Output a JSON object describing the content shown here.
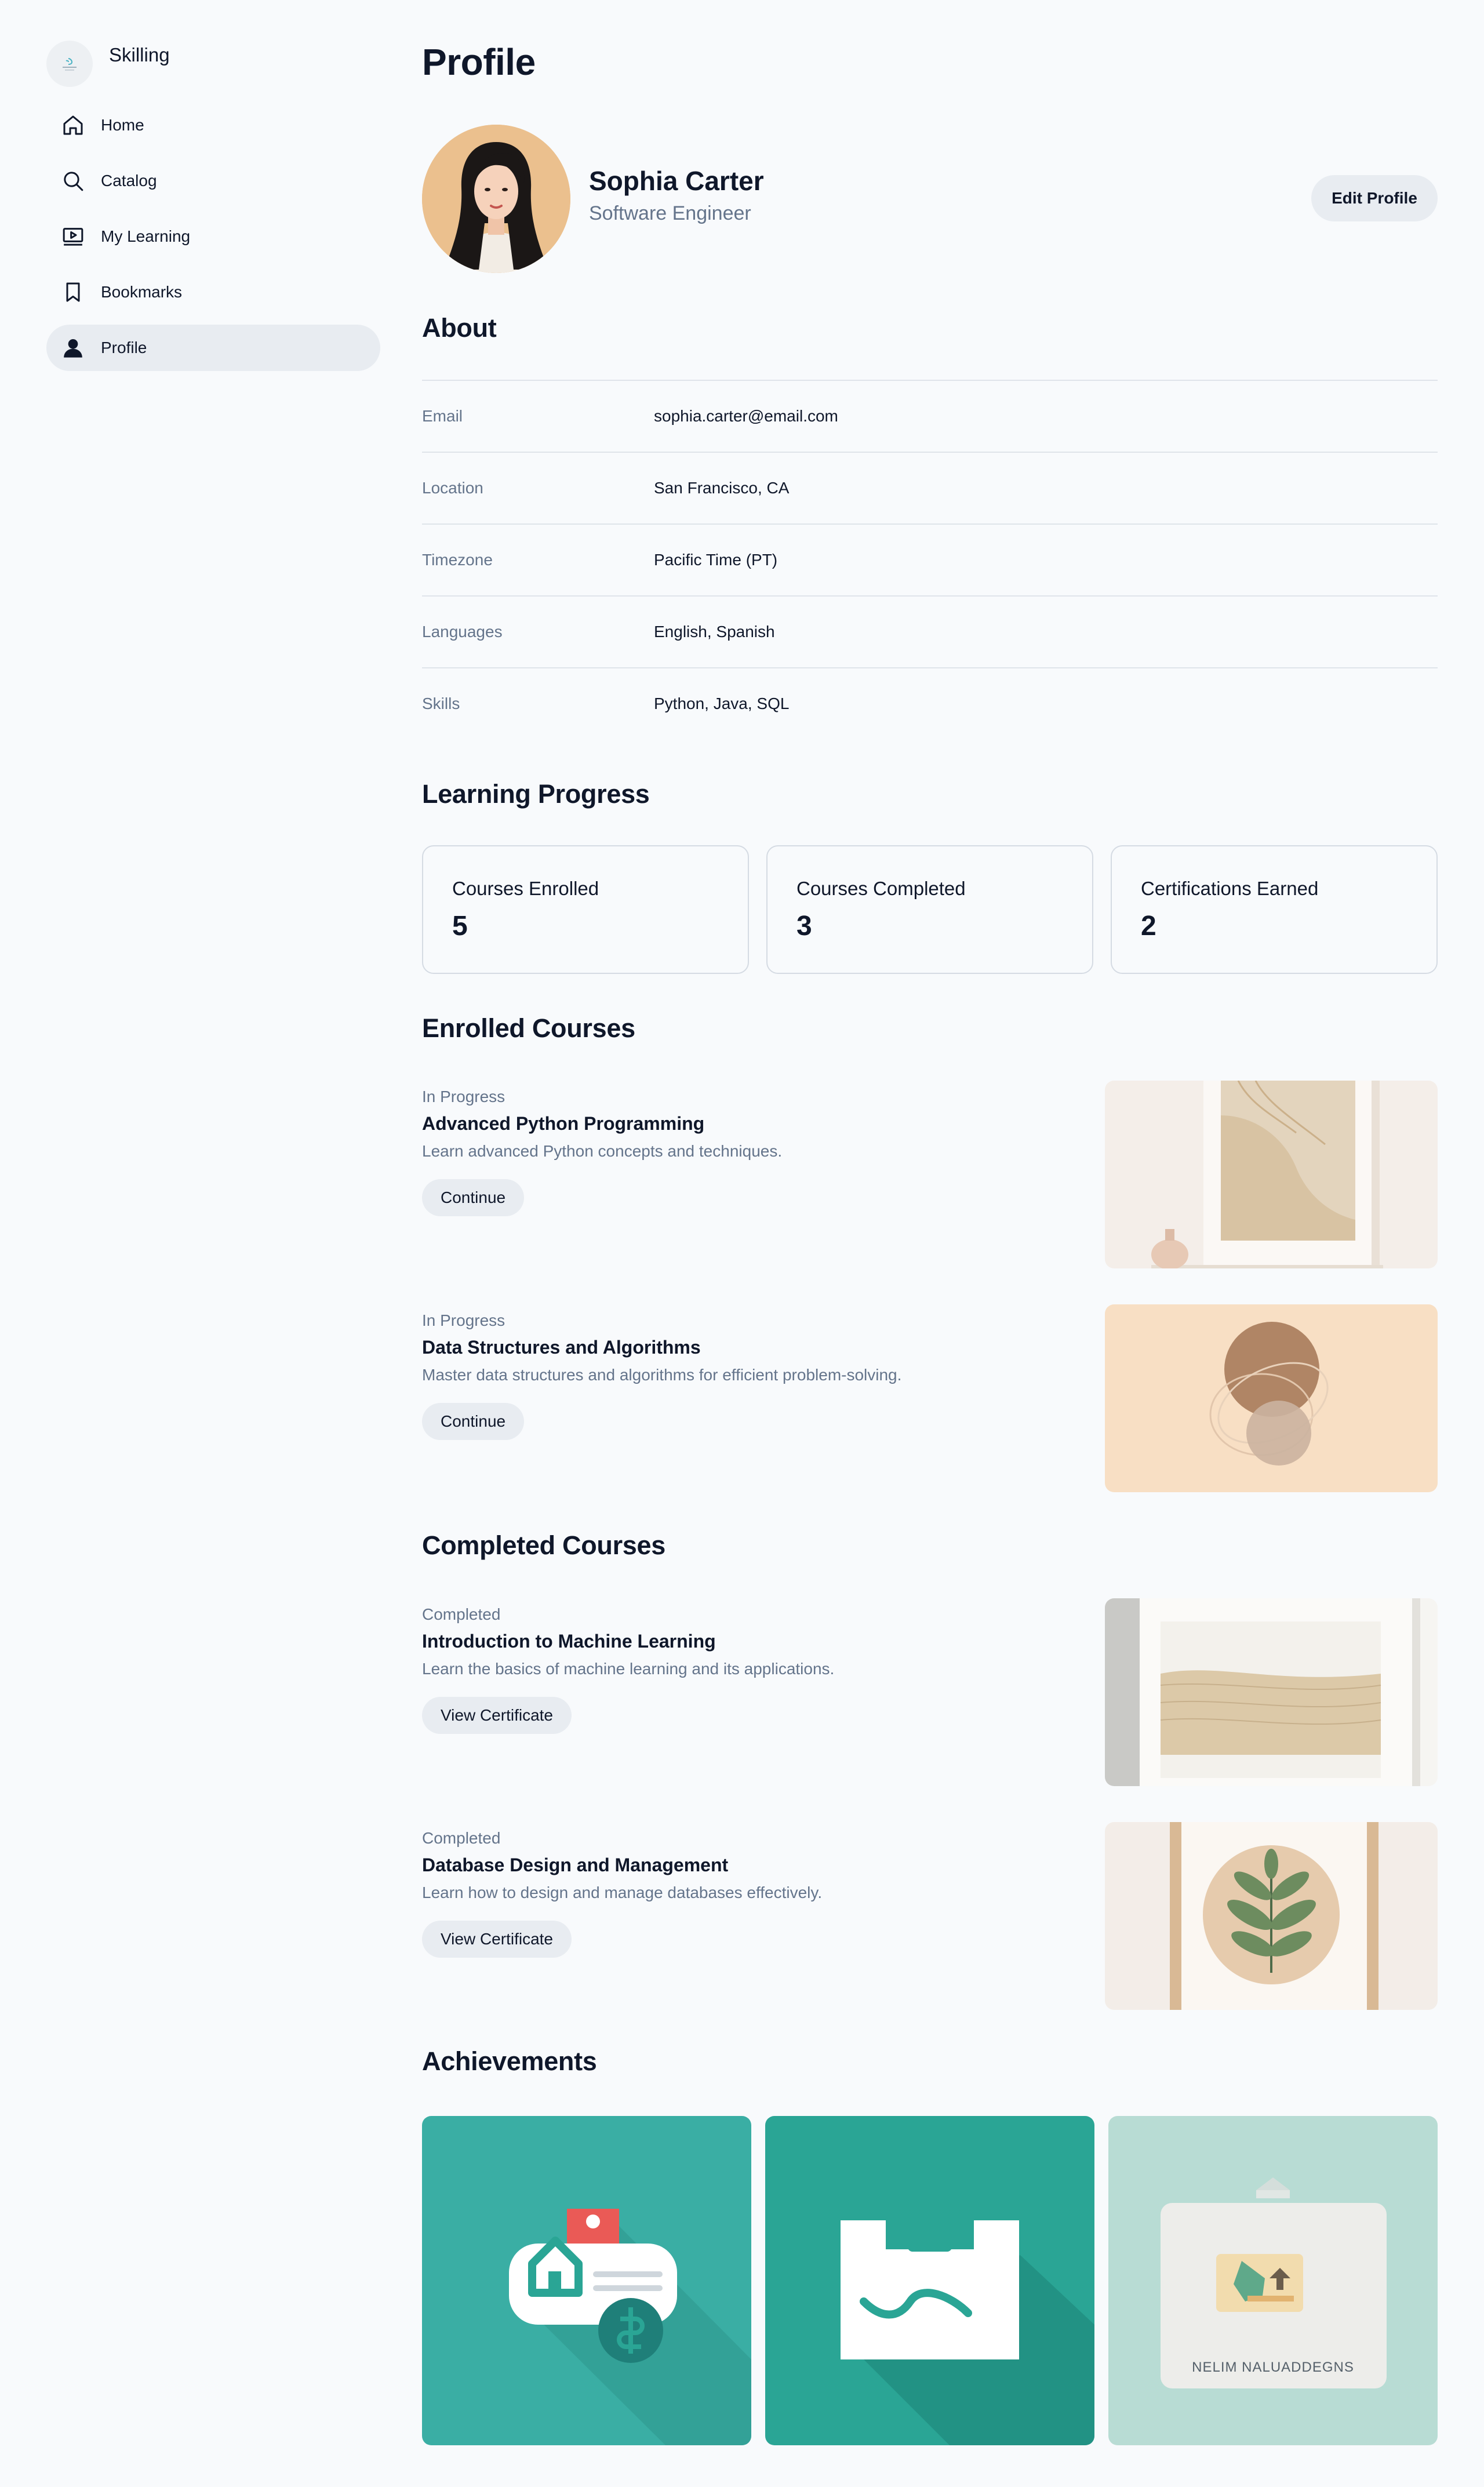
{
  "app": {
    "name": "Skilling"
  },
  "sidebar": {
    "items": [
      {
        "label": "Home",
        "icon": "home-icon"
      },
      {
        "label": "Catalog",
        "icon": "search-icon"
      },
      {
        "label": "My Learning",
        "icon": "video-icon"
      },
      {
        "label": "Bookmarks",
        "icon": "bookmark-icon"
      },
      {
        "label": "Profile",
        "icon": "user-icon",
        "active": true
      }
    ]
  },
  "page": {
    "title": "Profile"
  },
  "profile": {
    "name": "Sophia Carter",
    "role": "Software Engineer",
    "edit_label": "Edit Profile"
  },
  "about": {
    "title": "About",
    "rows": [
      {
        "key": "Email",
        "value": "sophia.carter@email.com"
      },
      {
        "key": "Location",
        "value": "San Francisco, CA"
      },
      {
        "key": "Timezone",
        "value": "Pacific Time (PT)"
      },
      {
        "key": "Languages",
        "value": "English, Spanish"
      },
      {
        "key": "Skills",
        "value": "Python, Java, SQL"
      }
    ]
  },
  "progress": {
    "title": "Learning Progress",
    "stats": [
      {
        "label": "Courses Enrolled",
        "value": "5"
      },
      {
        "label": "Courses Completed",
        "value": "3"
      },
      {
        "label": "Certifications Earned",
        "value": "2"
      }
    ]
  },
  "enrolled": {
    "title": "Enrolled Courses",
    "courses": [
      {
        "status": "In Progress",
        "title": "Advanced Python Programming",
        "desc": "Learn advanced Python concepts and techniques.",
        "action": "Continue"
      },
      {
        "status": "In Progress",
        "title": "Data Structures and Algorithms",
        "desc": "Master data structures and algorithms for efficient problem-solving.",
        "action": "Continue"
      }
    ]
  },
  "completed": {
    "title": "Completed Courses",
    "courses": [
      {
        "status": "Completed",
        "title": "Introduction to Machine Learning",
        "desc": "Learn the basics of machine learning and its applications.",
        "action": "View Certificate"
      },
      {
        "status": "Completed",
        "title": "Database Design and Management",
        "desc": "Learn how to design and manage databases effectively.",
        "action": "View Certificate"
      }
    ]
  },
  "achievements": {
    "title": "Achievements",
    "items": [
      {
        "icon": "badge-icon",
        "color": "#3aaea4"
      },
      {
        "icon": "certificate-icon",
        "color": "#2aa595"
      },
      {
        "icon": "award-icon",
        "color": "#b8dcd4",
        "caption": "NELIM NALUADDEGNS"
      }
    ]
  },
  "colors": {
    "accent": "#2aa595",
    "muted_text": "#64748b",
    "pill_bg": "#e8ecf1"
  }
}
